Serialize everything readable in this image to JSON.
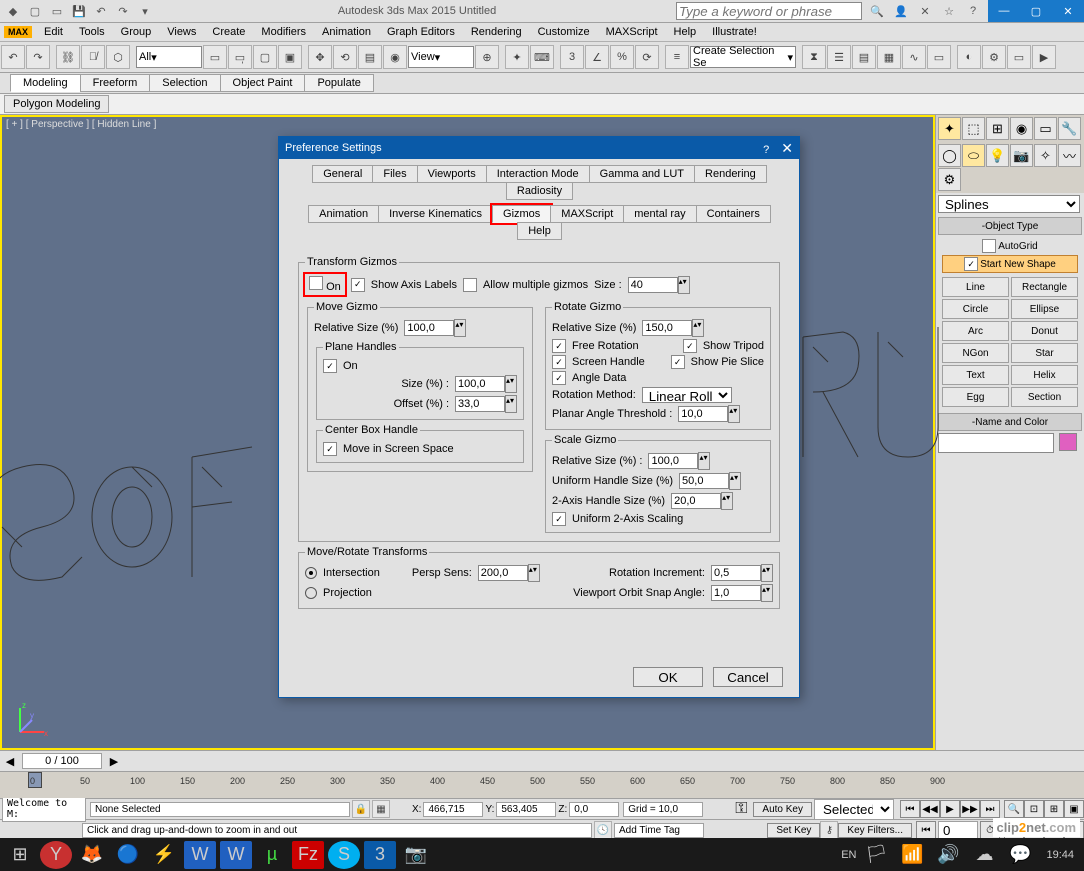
{
  "title": "Autodesk 3ds Max 2015   Untitled",
  "help_placeholder": "Type a keyword or phrase",
  "max_badge": "MAX",
  "menus": [
    "Edit",
    "Tools",
    "Group",
    "Views",
    "Create",
    "Modifiers",
    "Animation",
    "Graph Editors",
    "Rendering",
    "Customize",
    "MAXScript",
    "Help",
    "Illustrate!"
  ],
  "toolbar": {
    "all": "All",
    "view": "View",
    "selset": "Create Selection Se"
  },
  "subtabs": [
    "Modeling",
    "Freeform",
    "Selection",
    "Object Paint",
    "Populate"
  ],
  "modetab": "Polygon Modeling",
  "viewport_label": "[ + ] [ Perspective ] [ Hidden Line ]",
  "panel": {
    "drop": "Splines",
    "objtype": "Object Type",
    "autogrid": "AutoGrid",
    "startshape": "Start New Shape",
    "objs": [
      "Line",
      "Rectangle",
      "Circle",
      "Ellipse",
      "Arc",
      "Donut",
      "NGon",
      "Star",
      "Text",
      "Helix",
      "Egg",
      "Section"
    ],
    "namecolor": "Name and Color"
  },
  "dialog": {
    "title": "Preference Settings",
    "tabs1": [
      "General",
      "Files",
      "Viewports",
      "Interaction Mode",
      "Gamma and LUT",
      "Rendering",
      "Radiosity"
    ],
    "tabs2": [
      "Animation",
      "Inverse Kinematics",
      "Gizmos",
      "MAXScript",
      "mental ray",
      "Containers",
      "Help"
    ],
    "active_tab": "Gizmos",
    "transform": {
      "legend": "Transform Gizmos",
      "on": "On",
      "show_axis": "Show Axis Labels",
      "allow_multi": "Allow multiple gizmos",
      "size_lbl": "Size :",
      "size": "40"
    },
    "move": {
      "legend": "Move Gizmo",
      "rel_lbl": "Relative Size (%)",
      "rel": "100,0",
      "plane_legend": "Plane Handles",
      "plane_on": "On",
      "sz_lbl": "Size (%) :",
      "sz": "100,0",
      "off_lbl": "Offset (%) :",
      "off": "33,0",
      "center_legend": "Center Box Handle",
      "center_chk": "Move in Screen Space"
    },
    "rotate": {
      "legend": "Rotate Gizmo",
      "rel_lbl": "Relative Size (%)",
      "rel": "150,0",
      "free": "Free Rotation",
      "tripod": "Show Tripod",
      "screen": "Screen Handle",
      "pie": "Show Pie Slice",
      "angle": "Angle Data",
      "rotmethod_lbl": "Rotation Method:",
      "rotmethod": "Linear Roll",
      "planar_lbl": "Planar Angle Threshold :",
      "planar": "10,0"
    },
    "scale": {
      "legend": "Scale Gizmo",
      "rel_lbl": "Relative Size (%) :",
      "rel": "100,0",
      "uh_lbl": "Uniform Handle Size (%)",
      "uh": "50,0",
      "ax2_lbl": "2-Axis Handle Size (%)",
      "ax2": "20,0",
      "uni2": "Uniform 2-Axis Scaling"
    },
    "mrt": {
      "legend": "Move/Rotate Transforms",
      "intersection": "Intersection",
      "projection": "Projection",
      "persp_lbl": "Persp Sens:",
      "persp": "200,0",
      "rotinc_lbl": "Rotation Increment:",
      "rotinc": "0,5",
      "orbit_lbl": "Viewport Orbit Snap Angle:",
      "orbit": "1,0"
    },
    "ok": "OK",
    "cancel": "Cancel"
  },
  "timeline": {
    "frame": "0 / 100"
  },
  "ruler_ticks": [
    "0",
    "50",
    "100",
    "150",
    "200",
    "250",
    "300",
    "350",
    "400",
    "450",
    "500",
    "550",
    "600",
    "650",
    "700",
    "750",
    "800",
    "850",
    "900"
  ],
  "status": {
    "welcome": "Welcome to M:",
    "none": "None Selected",
    "x_lbl": "X:",
    "x": "466,715",
    "y_lbl": "Y:",
    "y": "563,405",
    "z_lbl": "Z:",
    "z": "0,0",
    "grid": "Grid = 10,0",
    "hint": "Click and drag up-and-down to zoom in and out",
    "addtag": "Add Time Tag",
    "autokey": "Auto Key",
    "selected": "Selected",
    "setkey": "Set Key",
    "keyfilters": "Key Filters..."
  },
  "tray": {
    "lang": "EN",
    "time": "19:44"
  },
  "watermark": "clip2net.com"
}
